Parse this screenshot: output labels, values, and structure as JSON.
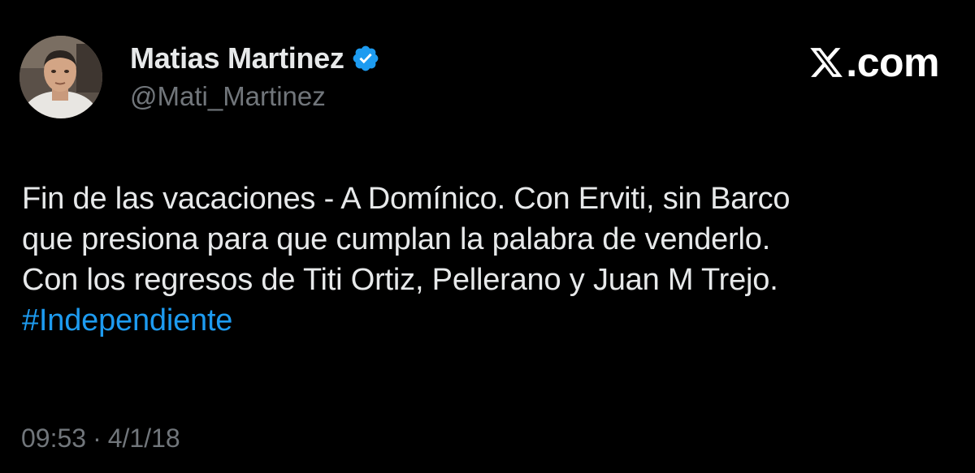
{
  "tweet": {
    "author": {
      "name": "Matias Martinez",
      "handle": "@Mati_Martinez",
      "verified": true,
      "avatar_icon": "profile-photo"
    },
    "brand": {
      "text": ".com",
      "icon": "x-logo-icon"
    },
    "text_lines": [
      "Fin de las vacaciones - A Domínico. Con Erviti, sin Barco",
      "que presiona para que cumplan la palabra de venderlo.",
      "Con los regresos de Titi Ortiz, Pellerano y Juan M Trejo."
    ],
    "hashtag": "#Independiente",
    "time": "09:53",
    "separator": "·",
    "date": "4/1/18"
  },
  "colors": {
    "background": "#000000",
    "primary_text": "#e7e9ea",
    "secondary_text": "#71767b",
    "link": "#1d9bf0",
    "verified_badge": "#1d9bf0"
  }
}
